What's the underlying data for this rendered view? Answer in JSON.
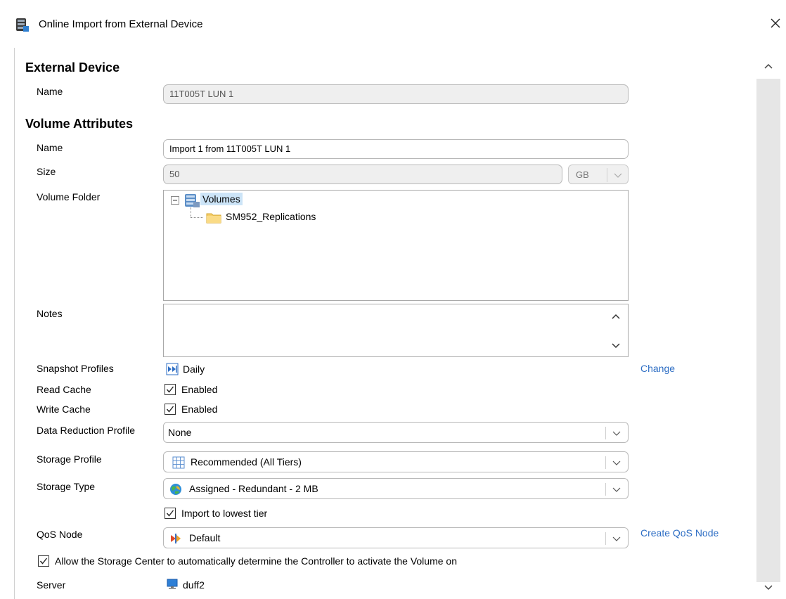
{
  "window": {
    "title": "Online Import from External Device"
  },
  "external_device": {
    "heading": "External Device",
    "name_label": "Name",
    "name_value": "11T005T LUN 1"
  },
  "volume_attributes": {
    "heading": "Volume Attributes",
    "name_label": "Name",
    "name_value": "Import 1 from 11T005T LUN 1",
    "size_label": "Size",
    "size_value": "50",
    "size_unit": "GB",
    "folder_label": "Volume Folder",
    "folder_tree": {
      "root": "Volumes",
      "child": "SM952_Replications"
    },
    "notes_label": "Notes",
    "notes_value": "",
    "snapshot_label": "Snapshot Profiles",
    "snapshot_value": "Daily",
    "snapshot_change": "Change",
    "read_cache_label": "Read Cache",
    "read_cache_value": "Enabled",
    "read_cache_checked": true,
    "write_cache_label": "Write Cache",
    "write_cache_value": "Enabled",
    "write_cache_checked": true,
    "data_reduction_label": "Data Reduction Profile",
    "data_reduction_value": "None",
    "storage_profile_label": "Storage Profile",
    "storage_profile_value": "Recommended (All Tiers)",
    "storage_type_label": "Storage Type",
    "storage_type_value": "Assigned - Redundant - 2 MB",
    "import_lowest_label": "Import to lowest tier",
    "import_lowest_checked": true,
    "qos_label": "QoS Node",
    "qos_value": "Default",
    "qos_create": "Create QoS Node",
    "allow_sc_label": "Allow the Storage Center to automatically determine the Controller to activate the Volume on",
    "allow_sc_checked": true,
    "server_label": "Server",
    "server_value": "duff2"
  },
  "colors": {
    "link": "#2e6ec4",
    "selection": "#cce4f7",
    "scroll_track": "#e6e6e6"
  },
  "icons": {
    "app": "storage-app-icon",
    "close": "close-icon",
    "volumes": "volumes-icon",
    "folder": "folder-icon",
    "snapshot": "snapshot-profile-icon",
    "storage_profile": "grid-icon",
    "storage_type": "globe-icon",
    "qos": "qos-icon",
    "server": "server-monitor-icon"
  }
}
